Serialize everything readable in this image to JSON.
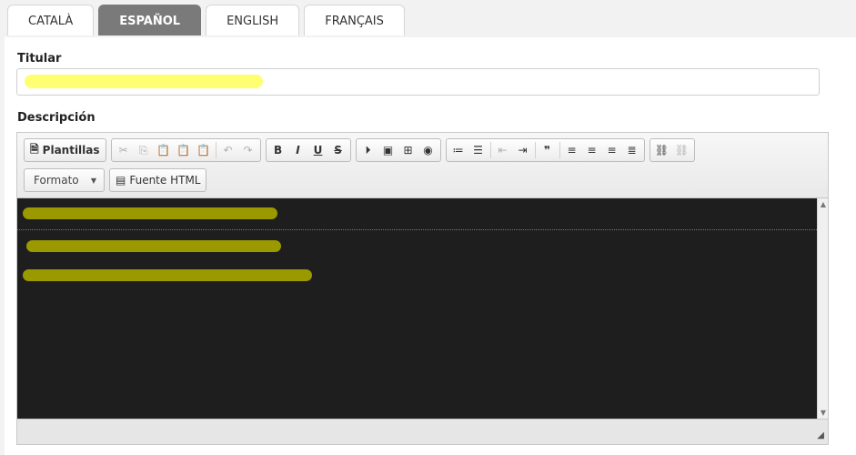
{
  "tabs": [
    "CATALÀ",
    "ESPAÑOL",
    "ENGLISH",
    "FRANÇAIS"
  ],
  "active_tab": "ESPAÑOL",
  "titular_label": "Titular",
  "descripcion_label": "Descripción",
  "toolbar": {
    "plantillas": "Plantillas",
    "formato": "Formato",
    "fuente_html": "Fuente HTML",
    "icons": {
      "plantillas": "document-icon",
      "cut": "cut-icon",
      "copy": "copy-icon",
      "paste": "paste-icon",
      "paste_text": "paste-text-icon",
      "paste_word": "paste-word-icon",
      "undo": "undo-icon",
      "redo": "redo-icon",
      "bold": "B",
      "italic": "I",
      "underline": "U",
      "strike": "S",
      "media": "play-icon",
      "image": "image-icon",
      "table": "table-icon",
      "iframe": "globe-icon",
      "ol": "numbered-list-icon",
      "ul": "bulleted-list-icon",
      "outdent": "outdent-icon",
      "indent": "indent-icon",
      "blockquote": "quote-icon",
      "align_left": "align-left-icon",
      "align_center": "align-center-icon",
      "align_right": "align-right-icon",
      "justify": "align-justify-icon",
      "link": "link-icon",
      "unlink": "unlink-icon"
    }
  },
  "colors": {
    "active_tab_bg": "#7a7a7a",
    "highlight": "#ffff66",
    "editor_bg": "#1e1e1e",
    "scribble": "#9a9a00"
  }
}
